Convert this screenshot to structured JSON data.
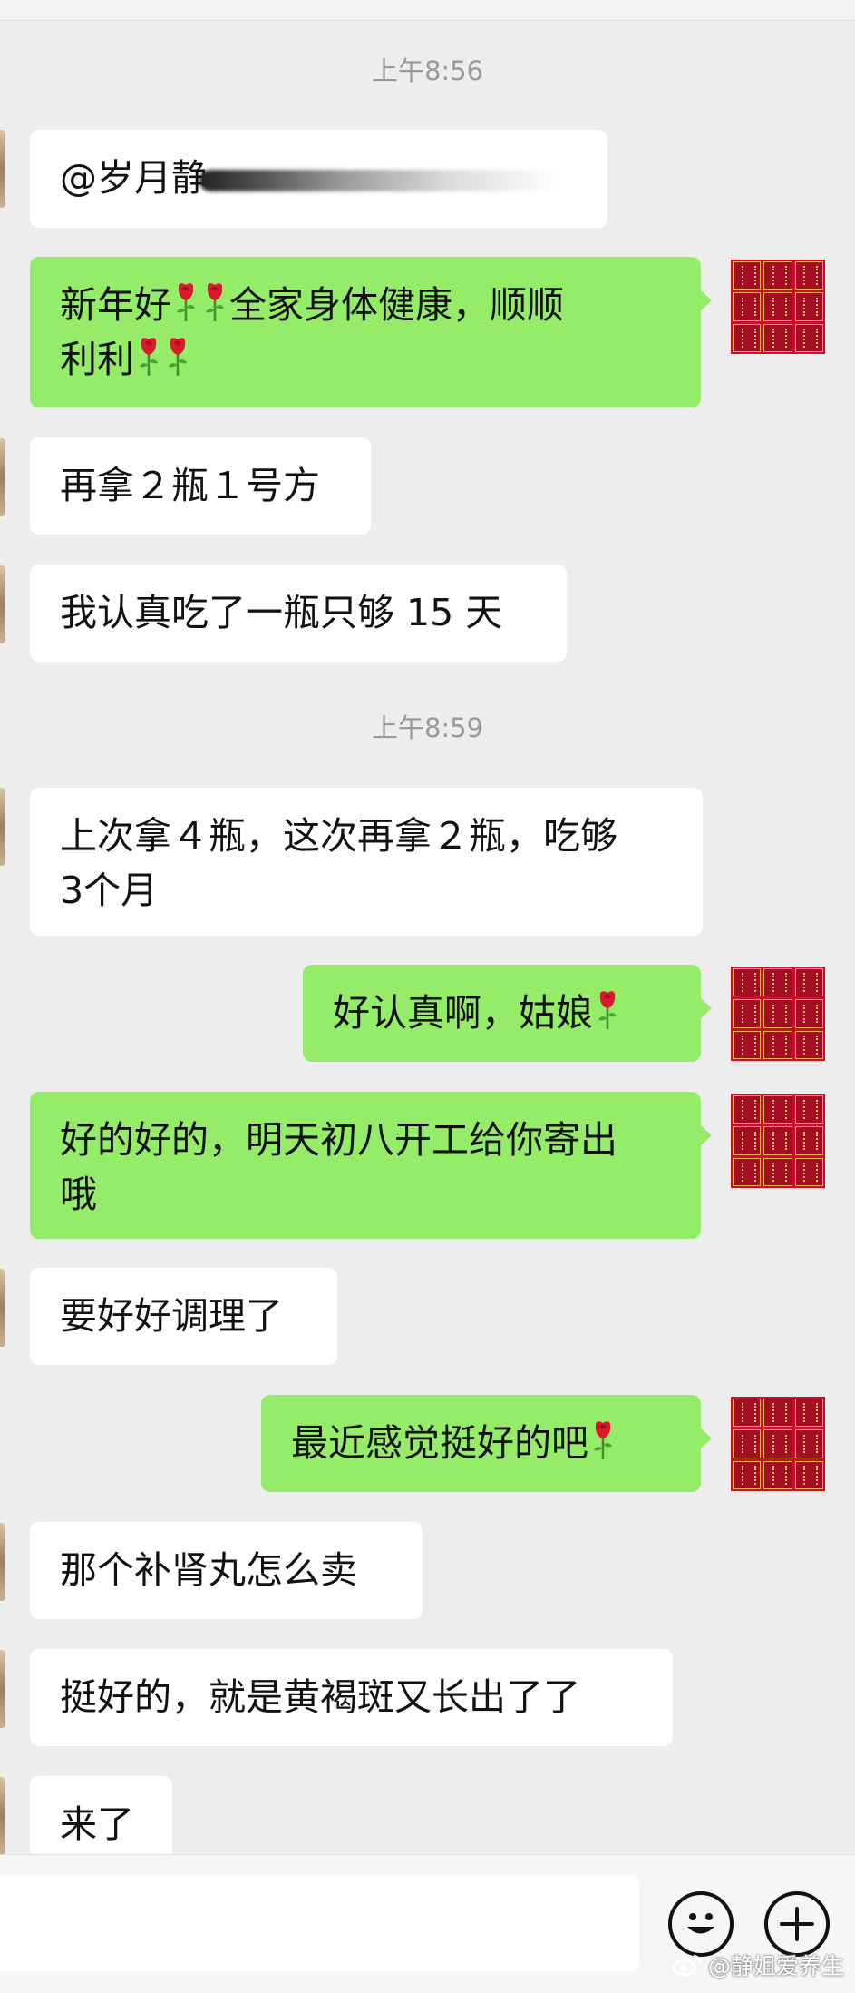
{
  "timestamps": [
    "上午8:56",
    "上午8:59"
  ],
  "messages": [
    {
      "dir": "in",
      "pre": "@岁月静",
      "masked": true
    },
    {
      "dir": "out",
      "line1_a": "新年好",
      "line1_b": "全家身体健康，顺顺",
      "line2": "利利"
    },
    {
      "dir": "in",
      "text": "再拿２瓶１号方"
    },
    {
      "dir": "in",
      "text": "我认真吃了一瓶只够 15 天"
    },
    {
      "dir": "in",
      "line1": "上次拿４瓶，这次再拿２瓶，吃够",
      "line2": "3个月"
    },
    {
      "dir": "out",
      "text": "好认真啊，姑娘"
    },
    {
      "dir": "out",
      "line1": "好的好的，明天初八开工给你寄出",
      "line2": "哦"
    },
    {
      "dir": "in",
      "text": "要好好调理了"
    },
    {
      "dir": "out",
      "text": "最近感觉挺好的吧"
    },
    {
      "dir": "in",
      "text": "那个补肾丸怎么卖"
    },
    {
      "dir": "in",
      "text": "挺好的，就是黄褐斑又长出了了"
    },
    {
      "dir": "in",
      "text": "来了"
    }
  ],
  "input_bar": {
    "emoji_icon": "smiley-icon",
    "plus_icon": "plus-icon"
  },
  "watermark": {
    "text": "@静姐爱养生"
  },
  "colors": {
    "background": "#ededed",
    "outgoing_bubble": "#95ec69",
    "incoming_bubble": "#ffffff",
    "timestamp": "#9a9a9a",
    "avatar_red": "#c8102e"
  }
}
